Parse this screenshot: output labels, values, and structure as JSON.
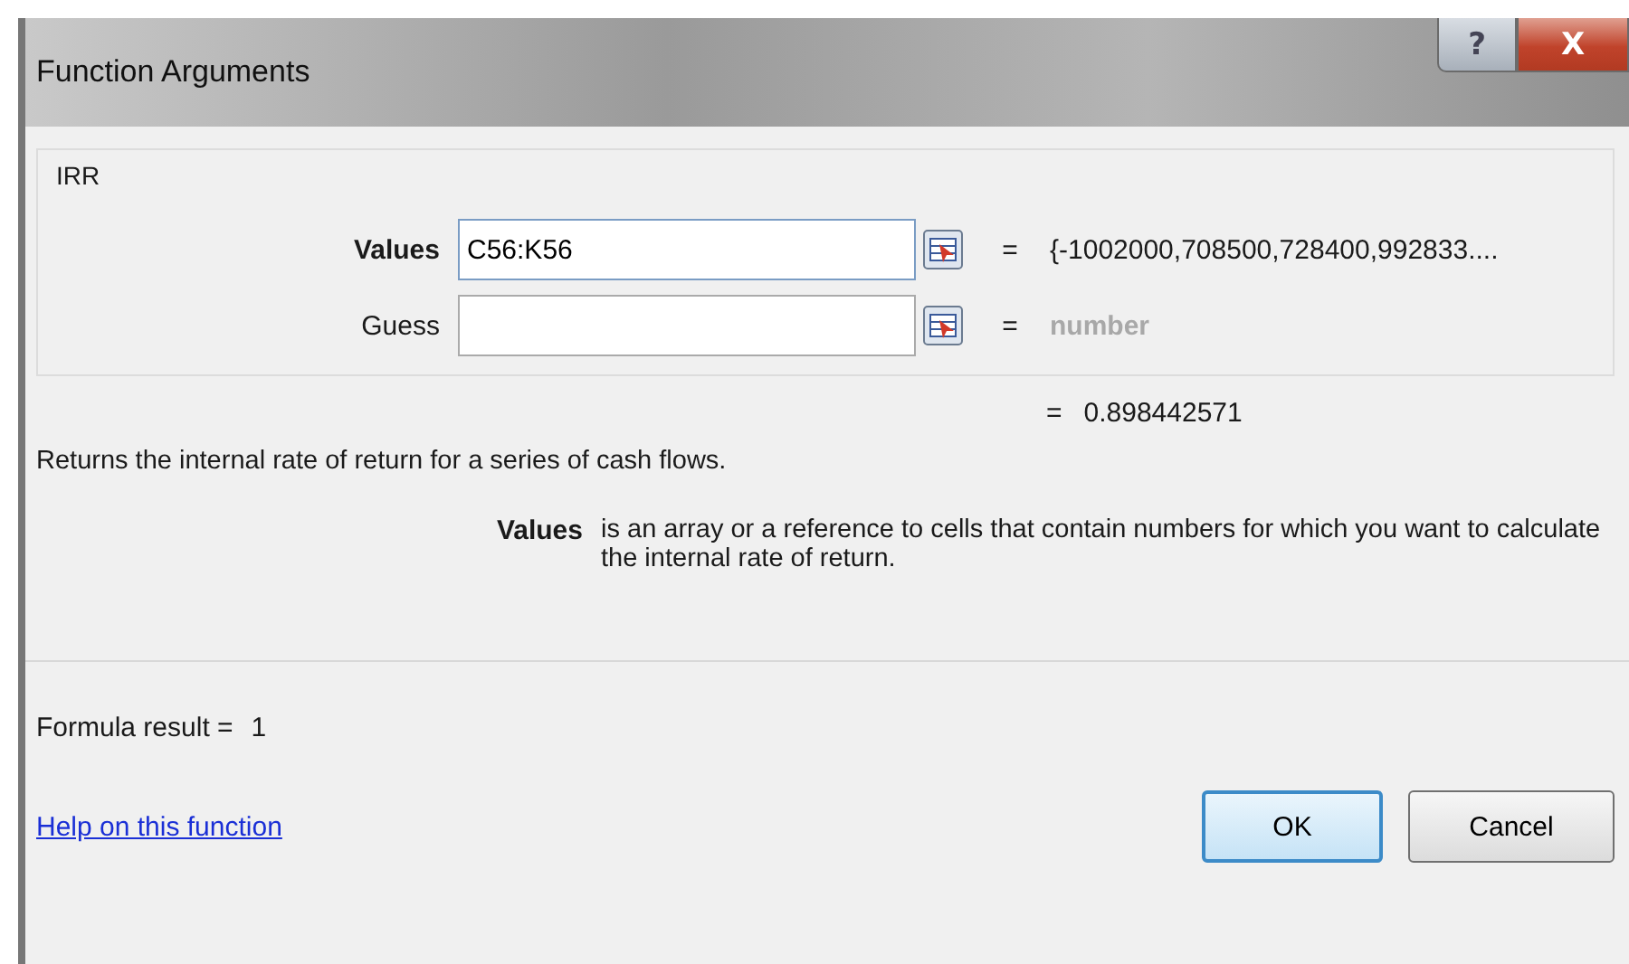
{
  "window": {
    "title": "Function Arguments",
    "controls": [
      {
        "kind": "help",
        "label": "?"
      },
      {
        "kind": "close",
        "label": "X"
      }
    ]
  },
  "group": {
    "title": "IRR"
  },
  "arguments": [
    {
      "label": "Values",
      "required": true,
      "value": "C56:K56",
      "focused": true,
      "equals": "=",
      "result": {
        "text": "{-1002000,708500,728400,992833....",
        "kind": "value"
      }
    },
    {
      "label": "Guess",
      "required": false,
      "focused": false,
      "equals": "=",
      "result": {
        "text": "number",
        "kind": "type"
      }
    }
  ],
  "function_result": {
    "equals": "=",
    "text": "0.898442571"
  },
  "description": "Returns the internal rate of return for a series of cash flows.",
  "argument_help": {
    "name": "Values",
    "text": "is an array or a reference to cells that contain numbers for which you want to calculate the internal rate of return."
  },
  "formula_result": {
    "label": "Formula result =",
    "value": "1"
  },
  "help_link": "Help on this function",
  "buttons": [
    {
      "label": "OK",
      "default": true
    },
    {
      "label": "Cancel",
      "default": false
    }
  ]
}
